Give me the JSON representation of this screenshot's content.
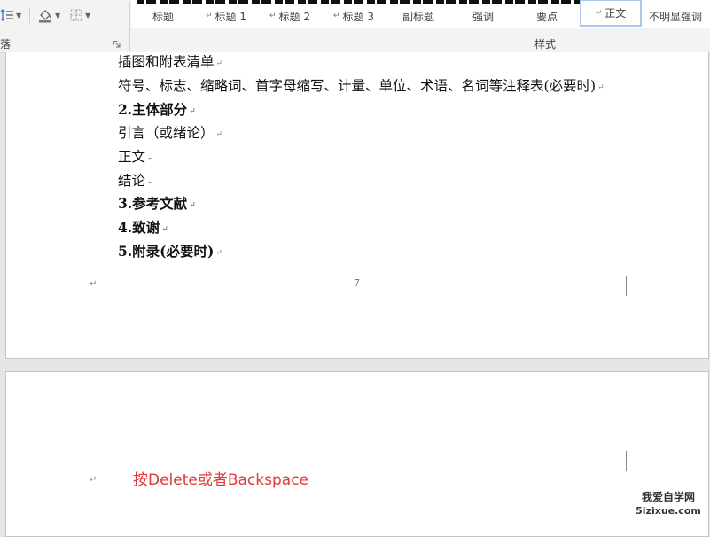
{
  "ribbon": {
    "paragraph_group_label": "落",
    "styles_group_label": "样式",
    "styles": [
      {
        "label": "标题",
        "marker": ""
      },
      {
        "label": "标题 1",
        "marker": "↵"
      },
      {
        "label": "标题 2",
        "marker": "↵"
      },
      {
        "label": "标题 3",
        "marker": "↵"
      },
      {
        "label": "副标题",
        "marker": ""
      },
      {
        "label": "强调",
        "marker": ""
      },
      {
        "label": "要点",
        "marker": ""
      },
      {
        "label": "正文",
        "marker": "↵"
      },
      {
        "label": "不明显强调",
        "marker": ""
      }
    ],
    "selected_style": "正文"
  },
  "page1": {
    "lines": [
      {
        "text": "插图和附表清单",
        "bold": false
      },
      {
        "text": "符号、标志、缩略词、首字母缩写、计量、单位、术语、名词等注释表(必要时)",
        "bold": false
      },
      {
        "text": "2.主体部分",
        "bold": true
      },
      {
        "text": "引言（或绪论）",
        "bold": false
      },
      {
        "text": "正文",
        "bold": false
      },
      {
        "text": "结论",
        "bold": false
      },
      {
        "text": "3.参考文献",
        "bold": true
      },
      {
        "text": "4.致谢",
        "bold": true
      },
      {
        "text": "5.附录(必要时)",
        "bold": true
      }
    ],
    "page_number": "7",
    "paragraph_mark": "↵"
  },
  "page2": {
    "paragraph_mark": "↵",
    "annotation": "按Delete或者Backspace",
    "annotation_color": "#e03a3a"
  },
  "watermark": {
    "line1": "我爱自学网",
    "line2": "5izixue.com"
  }
}
